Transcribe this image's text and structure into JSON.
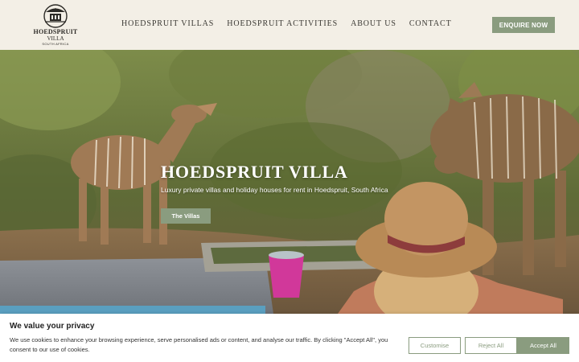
{
  "brand": {
    "logo_name": "HOEDSPRUIT",
    "logo_sub": "VILLA",
    "logo_tag": "SOUTH AFRICA"
  },
  "nav": {
    "items": [
      {
        "label": "HOEDSPRUIT VILLAS"
      },
      {
        "label": "HOEDSPRUIT ACTIVITIES"
      },
      {
        "label": "ABOUT US"
      },
      {
        "label": "CONTACT"
      }
    ],
    "cta_label": "ENQUIRE NOW"
  },
  "hero": {
    "title": "HOEDSPRUIT VILLA",
    "subtitle": "Luxury private villas and holiday houses for rent in Hoedspruit, South Africa",
    "button_label": "The Villas"
  },
  "cookie": {
    "title": "We value your privacy",
    "text": "We use cookies to enhance your browsing experience, serve personalised ads or content, and analyse our traffic. By clicking \"Accept All\", you consent to our use of cookies.",
    "customise_label": "Customise",
    "reject_label": "Reject All",
    "accept_label": "Accept All"
  },
  "colors": {
    "accent": "#8a9c7f",
    "header_bg": "#f3efe6",
    "text_dark": "#3a3833"
  }
}
